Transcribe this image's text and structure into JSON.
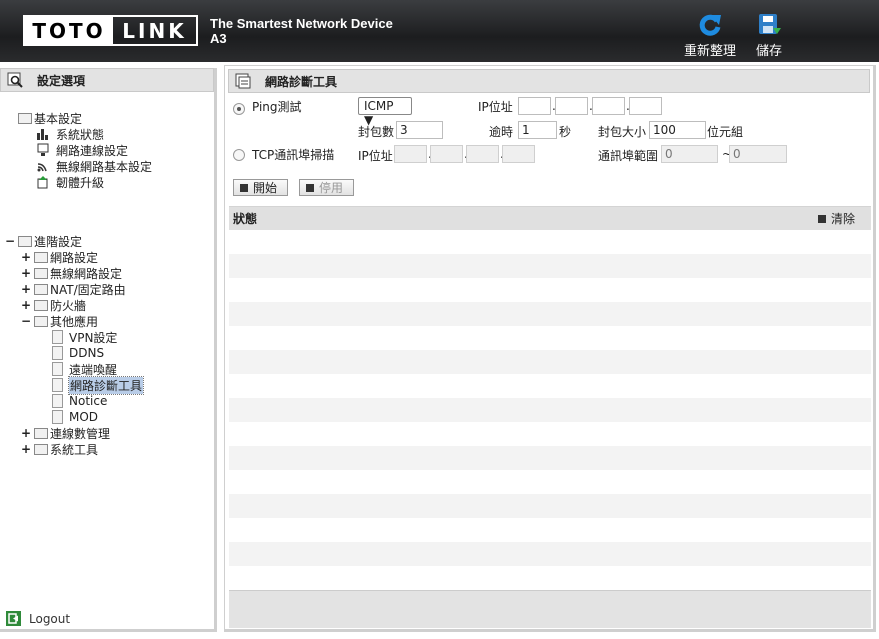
{
  "header": {
    "logo_left": "TOTO",
    "logo_right": "LINK",
    "tagline": "The Smartest Network Device",
    "model": "A3",
    "refresh_label": "重新整理",
    "save_label": "儲存"
  },
  "sidebar": {
    "title": "設定選項",
    "basic": {
      "label": "基本設定",
      "items": [
        "系統狀態",
        "網路連線設定",
        "無線網路基本設定",
        "韌體升級"
      ]
    },
    "advanced": {
      "label": "進階設定",
      "items": [
        "網路設定",
        "無線網路設定",
        "NAT/固定路由",
        "防火牆",
        "其他應用",
        "連線數管理",
        "系統工具"
      ],
      "other_items": [
        "VPN設定",
        "DDNS",
        "遠端喚醒",
        "網路診斷工具",
        "Notice",
        "MOD"
      ]
    },
    "logout": "Logout"
  },
  "main": {
    "title": "網路診斷工具",
    "ping": {
      "label": "Ping測試",
      "protocol": "ICMP ▼",
      "ip_label": "IP位址",
      "count_label": "封包數",
      "count_value": "3",
      "timeout_label": "逾時",
      "timeout_value": "1",
      "timeout_unit": "秒",
      "size_label": "封包大小",
      "size_value": "100",
      "size_unit": "位元組"
    },
    "tcp": {
      "label": "TCP通訊埠掃描",
      "ip_label": "IP位址",
      "port_label": "通訊埠範圍",
      "port_from": "0",
      "port_sep": "~",
      "port_to": "0"
    },
    "start_label": "開始",
    "stop_label": "停用",
    "status_label": "狀態",
    "clear_label": "清除"
  }
}
